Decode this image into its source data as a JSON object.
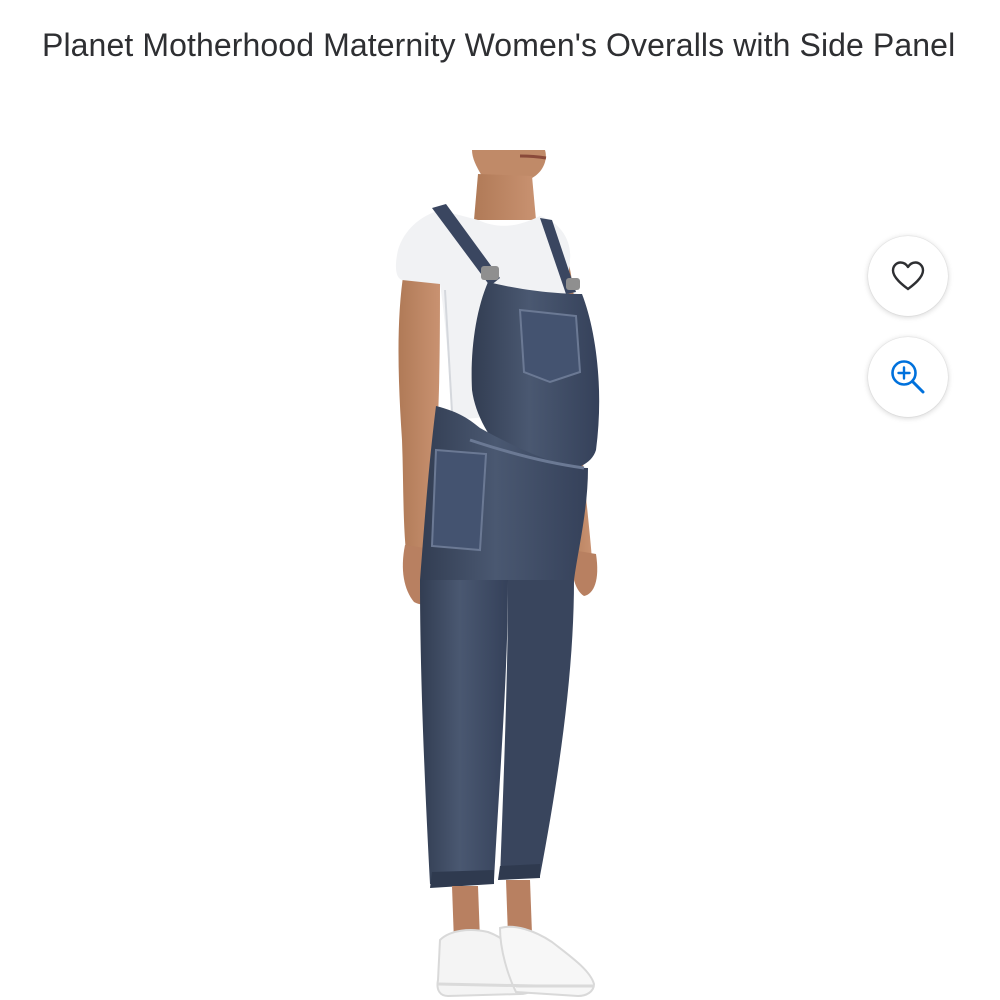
{
  "product": {
    "title": "Planet Motherhood Maternity Women's Overalls with Side Panel"
  },
  "image_actions": {
    "favorite_icon": "heart-icon",
    "zoom_icon": "zoom-in-icon",
    "zoom_color": "#0071dc"
  },
  "colors": {
    "text": "#2e2f32",
    "denim": "#3f4d66",
    "accent": "#0071dc"
  }
}
